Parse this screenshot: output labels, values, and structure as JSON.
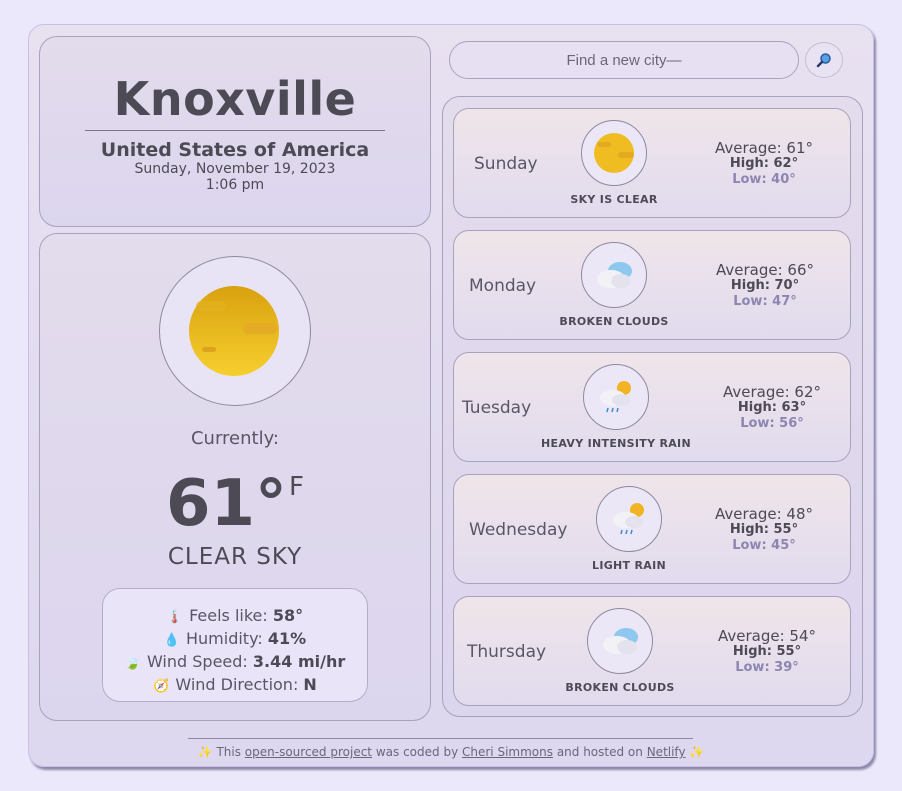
{
  "location": {
    "city": "Knoxville",
    "country": "United States of America",
    "date": "Sunday, November 19, 2023",
    "time": "1:06 pm"
  },
  "current": {
    "label": "Currently:",
    "temp": "61°",
    "unit": "F",
    "condition": "CLEAR SKY",
    "icon": "sun-icon",
    "details": {
      "feels_label": "Feels like:",
      "feels_value": "58°",
      "humidity_label": "Humidity:",
      "humidity_value": "41%",
      "wind_speed_label": "Wind Speed:",
      "wind_speed_value": "3.44 mi/hr",
      "wind_dir_label": "Wind Direction:",
      "wind_dir_value": "N"
    }
  },
  "search": {
    "placeholder": "Find a new city—",
    "button_icon": "magnifier-icon"
  },
  "forecast": [
    {
      "day": "Sunday",
      "desc": "SKY IS CLEAR",
      "icon": "sun-icon",
      "avg": "Average: 61°",
      "high": "High: 62°",
      "low": "Low: 40°"
    },
    {
      "day": "Monday",
      "desc": "BROKEN CLOUDS",
      "icon": "cloud-icon",
      "avg": "Average: 66°",
      "high": "High: 70°",
      "low": "Low: 47°"
    },
    {
      "day": "Tuesday",
      "desc": "HEAVY INTENSITY RAIN",
      "icon": "rain-sun-icon",
      "avg": "Average: 62°",
      "high": "High: 63°",
      "low": "Low: 56°"
    },
    {
      "day": "Wednesday",
      "desc": "LIGHT RAIN",
      "icon": "rain-sun-icon",
      "avg": "Average: 48°",
      "high": "High: 55°",
      "low": "Low: 45°"
    },
    {
      "day": "Thursday",
      "desc": "BROKEN CLOUDS",
      "icon": "cloud-icon",
      "avg": "Average: 54°",
      "high": "High: 55°",
      "low": "Low: 39°"
    }
  ],
  "footer": {
    "sparkle": "✨",
    "prefix": "This",
    "link1": "open-sourced project",
    "middle": "was coded by",
    "link2": "Cheri Simmons",
    "middle2": "and hosted on",
    "link3": "Netlify"
  }
}
